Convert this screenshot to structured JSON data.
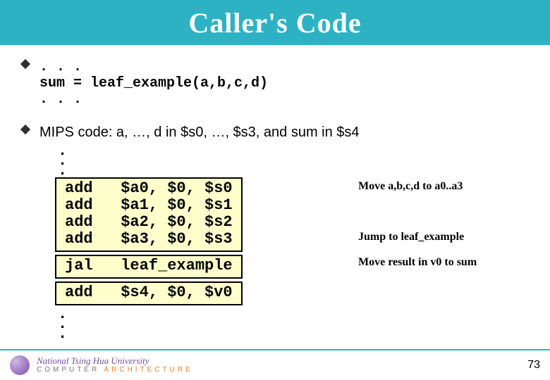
{
  "header": {
    "title": "Caller's Code"
  },
  "source_lines": {
    "l1": ". . .",
    "l2": "sum = leaf_example(a,b,c,d)",
    "l3": ". . ."
  },
  "mips_desc": "MIPS code: a, …, d in $s0, …, $s3, and sum in $s4",
  "code_box1": {
    "r1": "add   $a0, $0, $s0",
    "r2": "add   $a1, $0, $s1",
    "r3": "add   $a2, $0, $s2",
    "r4": "add   $a3, $0, $s3"
  },
  "code_box2": {
    "r1": "jal   leaf_example"
  },
  "code_box3": {
    "r1": "add   $s4, $0, $v0"
  },
  "notes": {
    "n1": "Move a,b,c,d to a0..a3",
    "n2": "Jump to leaf_example",
    "n3": "Move result in v0 to sum"
  },
  "footer": {
    "university": "National  Tsing  Hua  University",
    "dept_left": "COMPUTER",
    "dept_right": " ARCHITECTURE",
    "page": "73"
  }
}
